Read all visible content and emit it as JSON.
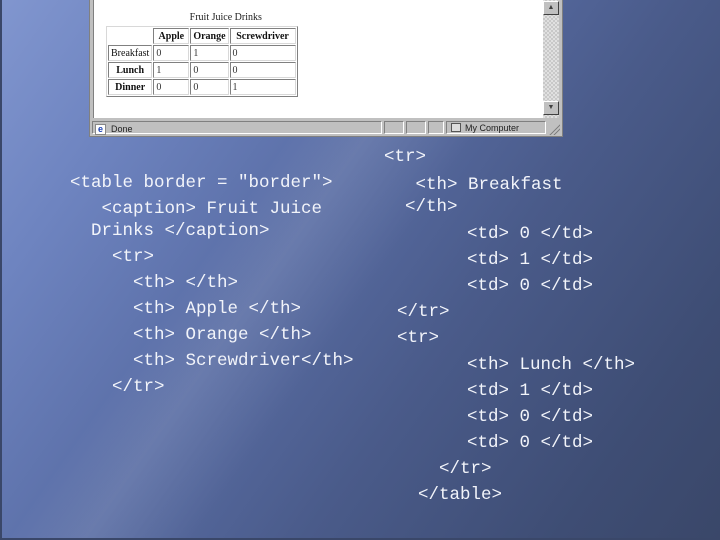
{
  "browser": {
    "caption": "Fruit Juice Drinks",
    "table": {
      "headers": [
        "",
        "Apple",
        "Orange",
        "Screwdriver"
      ],
      "rows": [
        {
          "label": "Breakfast",
          "values": [
            "0",
            "1",
            "0"
          ]
        },
        {
          "label": "Lunch",
          "values": [
            "1",
            "0",
            "0"
          ]
        },
        {
          "label": "Dinner",
          "values": [
            "0",
            "0",
            "1"
          ]
        }
      ]
    },
    "status": {
      "text": "Done",
      "zone": "My Computer"
    },
    "scroll_up_glyph": "▲",
    "scroll_down_glyph": "▼",
    "ie_glyph": "e"
  },
  "code_left": [
    "<table border = \"border\">",
    "   <caption> Fruit Juice",
    "  Drinks </caption>",
    "    <tr>",
    "      <th> </th>",
    "      <th> Apple </th>",
    "      <th> Orange </th>",
    "      <th> Screwdriver</th>",
    "    </tr>"
  ],
  "code_right": [
    "<tr>",
    "   <th> Breakfast",
    "  </th>",
    "      <td> 0 </td>",
    "      <td> 1 </td>",
    "      <td> 0 </td>",
    "</tr>",
    "<tr>",
    "      <th> Lunch </th>",
    "      <td> 1 </td>",
    "      <td> 0 </td>",
    "      <td> 0 </td>",
    "    </tr>",
    "  </table>"
  ]
}
